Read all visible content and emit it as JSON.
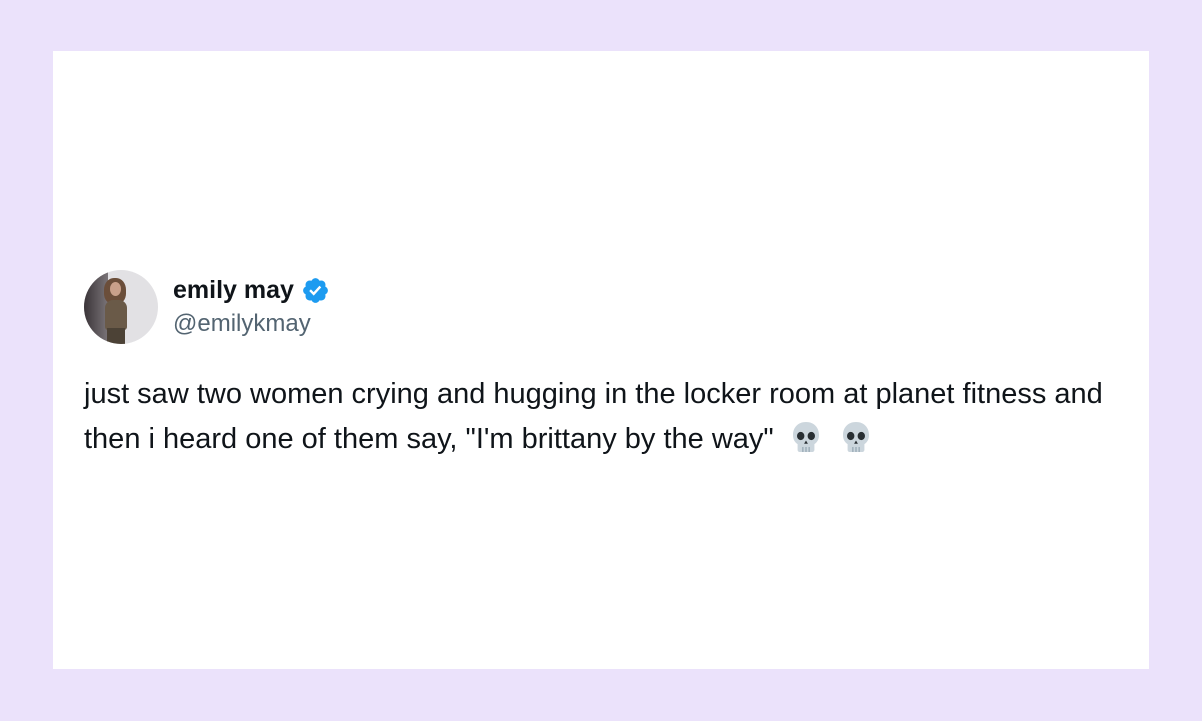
{
  "background_color": "#ebe2fb",
  "card_color": "#ffffff",
  "tweet": {
    "author": {
      "display_name": "emily may",
      "handle": "@emilykmay",
      "verified": true,
      "verified_badge_color": "#1d9bf0",
      "avatar_icon": "profile-photo"
    },
    "text": "just saw two women crying and hugging in the locker room at planet fitness and then i heard one of them say, \"I'm brittany by the way\"",
    "emojis": [
      "skull-icon",
      "skull-icon"
    ]
  }
}
